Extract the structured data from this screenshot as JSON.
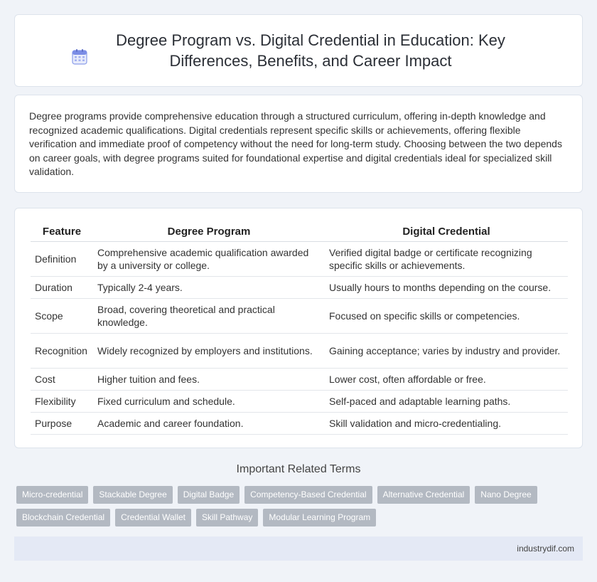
{
  "title": "Degree Program vs. Digital Credential in Education: Key Differences, Benefits, and Career Impact",
  "title_icon": "calendar-icon",
  "intro": "Degree programs provide comprehensive education through a structured curriculum, offering in-depth knowledge and recognized academic qualifications. Digital credentials represent specific skills or achievements, offering flexible verification and immediate proof of competency without the need for long-term study. Choosing between the two depends on career goals, with degree programs suited for foundational expertise and digital credentials ideal for specialized skill validation.",
  "table": {
    "headers": [
      "Feature",
      "Degree Program",
      "Digital Credential"
    ],
    "rows": [
      [
        "Definition",
        "Comprehensive academic qualification awarded by a university or college.",
        "Verified digital badge or certificate recognizing specific skills or achievements."
      ],
      [
        "Duration",
        "Typically 2-4 years.",
        "Usually hours to months depending on the course."
      ],
      [
        "Scope",
        "Broad, covering theoretical and practical knowledge.",
        "Focused on specific skills or competencies."
      ],
      [
        "Recognition",
        "Widely recognized by employers and institutions.",
        "Gaining acceptance; varies by industry and provider."
      ],
      [
        "Cost",
        "Higher tuition and fees.",
        "Lower cost, often affordable or free."
      ],
      [
        "Flexibility",
        "Fixed curriculum and schedule.",
        "Self-paced and adaptable learning paths."
      ],
      [
        "Purpose",
        "Academic and career foundation.",
        "Skill validation and micro-credentialing."
      ]
    ]
  },
  "related": {
    "title": "Important Related Terms",
    "tags": [
      "Micro-credential",
      "Stackable Degree",
      "Digital Badge",
      "Competency-Based Credential",
      "Alternative Credential",
      "Nano Degree",
      "Blockchain Credential",
      "Credential Wallet",
      "Skill Pathway",
      "Modular Learning Program"
    ]
  },
  "footer": "industrydif.com",
  "colors": {
    "background": "#f0f3f8",
    "tag": "#b3b9c2",
    "footer": "#e4e9f5",
    "icon": "#7b8de6"
  }
}
